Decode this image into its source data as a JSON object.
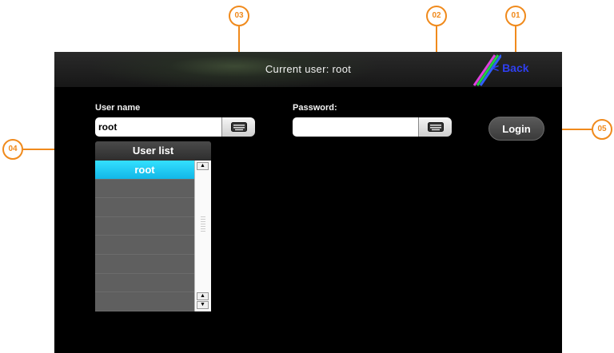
{
  "header": {
    "title": "Current user: root",
    "back_label": "< Back"
  },
  "username": {
    "label": "User name",
    "value": "root"
  },
  "password": {
    "label": "Password:",
    "value": ""
  },
  "login_label": "Login",
  "user_list": {
    "title": "User list",
    "items": [
      "root",
      "",
      "",
      "",
      "",
      "",
      "",
      ""
    ],
    "selected": "root"
  },
  "callouts": [
    "01",
    "02",
    "03",
    "04",
    "05"
  ],
  "colors": {
    "accent": "#f08a1c",
    "selection": "#1fc7f0",
    "back_link": "#2f3ff0"
  }
}
